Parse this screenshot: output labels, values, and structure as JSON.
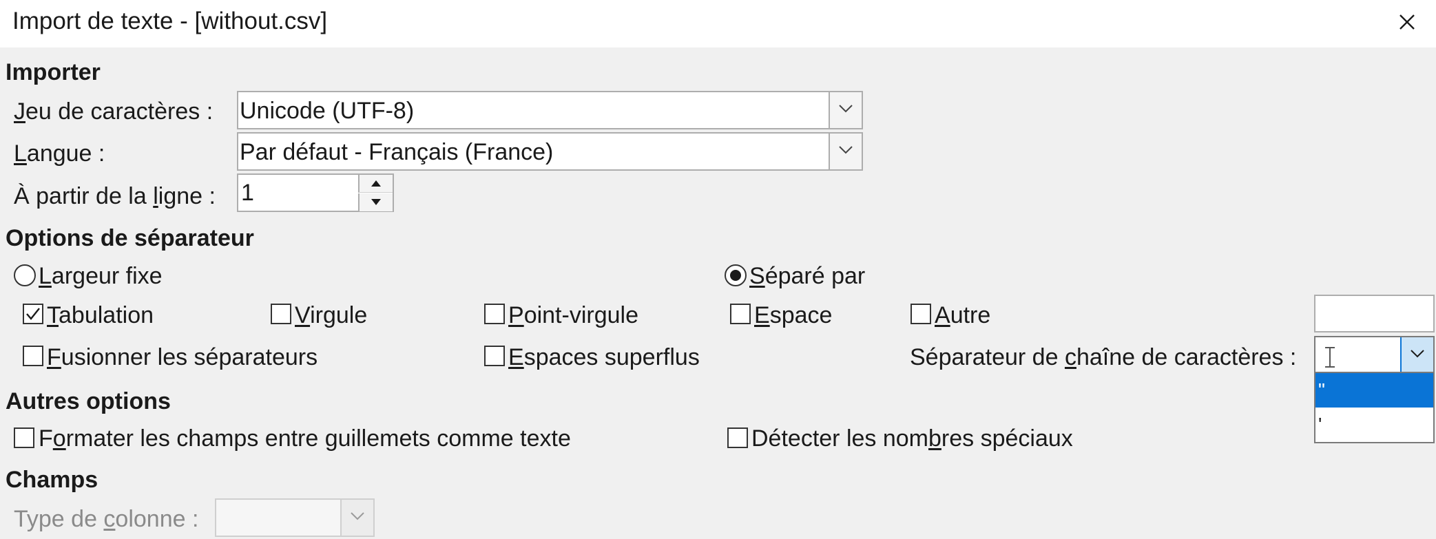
{
  "window": {
    "title": "Import de texte - [without.csv]"
  },
  "import": {
    "header": "Importer",
    "charset": {
      "label_ul": "J",
      "label_rest": "eu de caractères :",
      "value": "Unicode (UTF-8)"
    },
    "language": {
      "label_ul": "L",
      "label_rest": "angue :",
      "value": "Par défaut - Français (France)"
    },
    "from_row": {
      "label_pre": "À partir de la ",
      "label_ul": "l",
      "label_rest": "igne :",
      "value": "1"
    }
  },
  "separator": {
    "header": "Options de séparateur",
    "fixed_width": {
      "ul": "L",
      "rest": "argeur fixe",
      "selected": false
    },
    "separated_by": {
      "ul": "S",
      "rest": "éparé par",
      "selected": true
    },
    "tab": {
      "ul": "T",
      "rest": "abulation",
      "checked": true
    },
    "comma": {
      "ul": "V",
      "rest": "irgule",
      "checked": false
    },
    "semicolon": {
      "ul": "P",
      "rest": "oint-virgule",
      "checked": false
    },
    "space": {
      "ul": "E",
      "rest": "space",
      "checked": false
    },
    "other": {
      "ul": "A",
      "rest": "utre",
      "checked": false,
      "value": ""
    },
    "merge": {
      "ul": "F",
      "rest": "usionner les séparateurs",
      "checked": false
    },
    "trim": {
      "ul": "E",
      "rest": "spaces superflus",
      "checked": false
    },
    "string_delimiter": {
      "label_pre": "Séparateur de ",
      "label_ul": "c",
      "label_rest": "haîne de caractères :",
      "value": "",
      "options": [
        "\"",
        "'"
      ],
      "selected_index": 0
    }
  },
  "other_options": {
    "header": "Autres options",
    "quoted_as_text": {
      "pre": "F",
      "ul": "o",
      "rest": "rmater les champs entre guillemets comme texte",
      "checked": false
    },
    "detect_special": {
      "pre": "Détecter les nom",
      "ul": "b",
      "rest": "res spéciaux",
      "checked": false
    }
  },
  "fields": {
    "header": "Champs",
    "column_type": {
      "label_pre": "Type de ",
      "label_ul": "c",
      "label_rest": "olonne :",
      "value": ""
    }
  },
  "colors": {
    "accent": "#0a74d6",
    "background": "#f0f0f0",
    "titlebar": "#ffffff"
  }
}
